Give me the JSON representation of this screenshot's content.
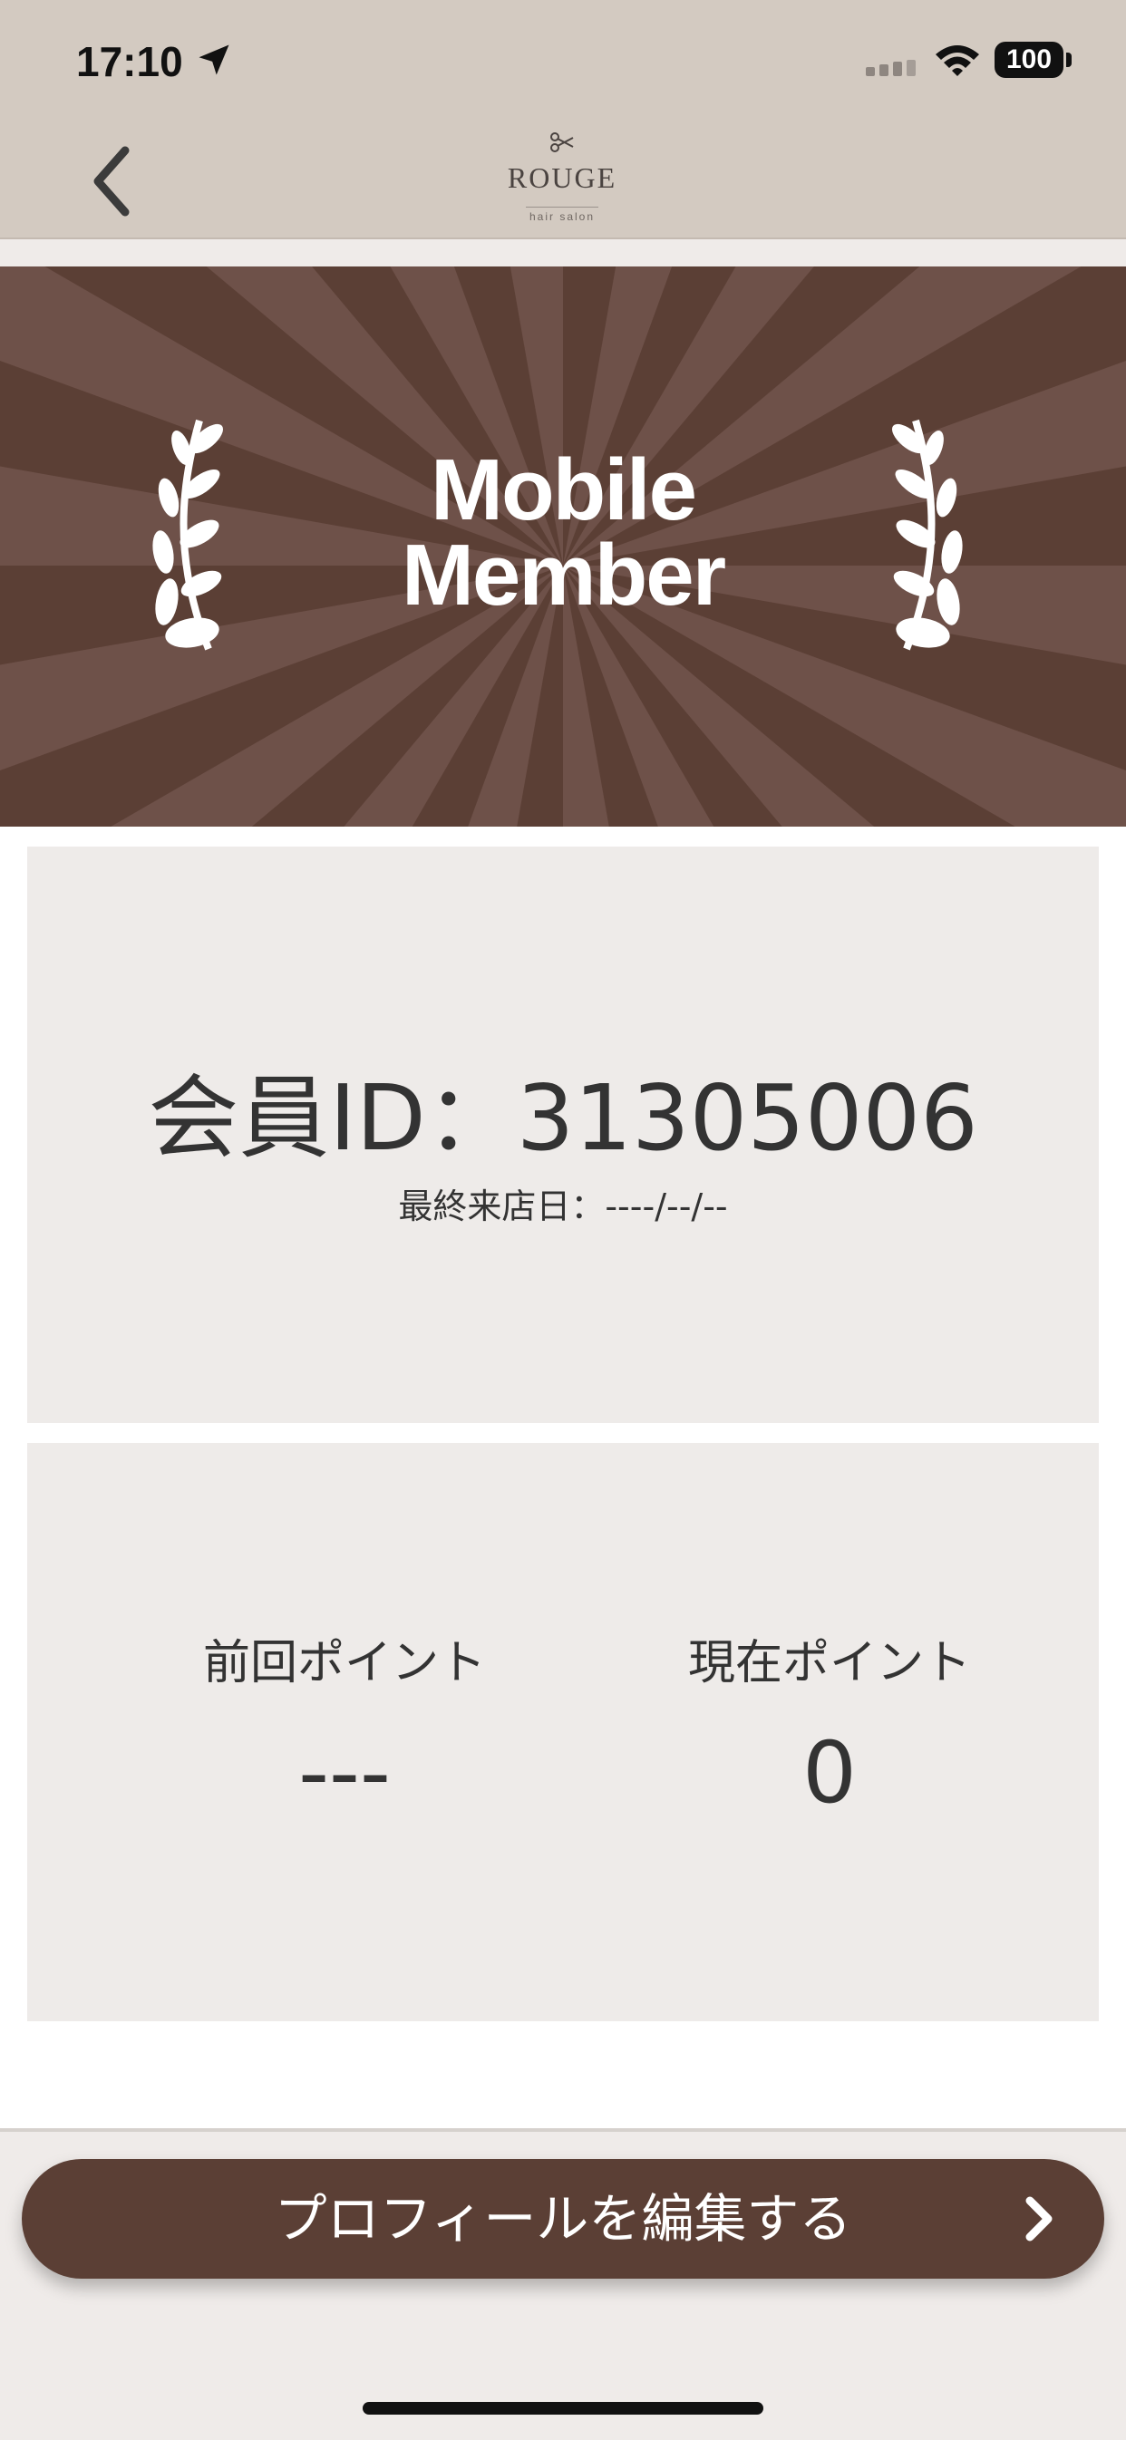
{
  "status_bar": {
    "time": "17:10",
    "battery": "100",
    "icons": [
      "location-arrow-icon",
      "cellular-signal-icon",
      "wifi-icon",
      "battery-icon"
    ]
  },
  "nav": {
    "back_icon": "chevron-left-icon",
    "logo_main": "ROUGE",
    "logo_sub": "hair salon",
    "logo_icon": "scissors-icon"
  },
  "banner": {
    "line1": "Mobile",
    "line2": "Member",
    "icons": [
      "laurel-left-icon",
      "laurel-right-icon"
    ],
    "colors": {
      "background": "#5b3f35",
      "ray": "#6e5149"
    }
  },
  "member": {
    "id_text": "会員ID：31305006",
    "last_visit_text": "最終来店日：----/--/--"
  },
  "points": {
    "previous_label": "前回ポイント",
    "previous_value": "---",
    "current_label": "現在ポイント",
    "current_value": "0"
  },
  "action": {
    "edit_profile_label": "プロフィールを編集する",
    "icon": "chevron-right-icon",
    "color": "#5b3f35"
  }
}
